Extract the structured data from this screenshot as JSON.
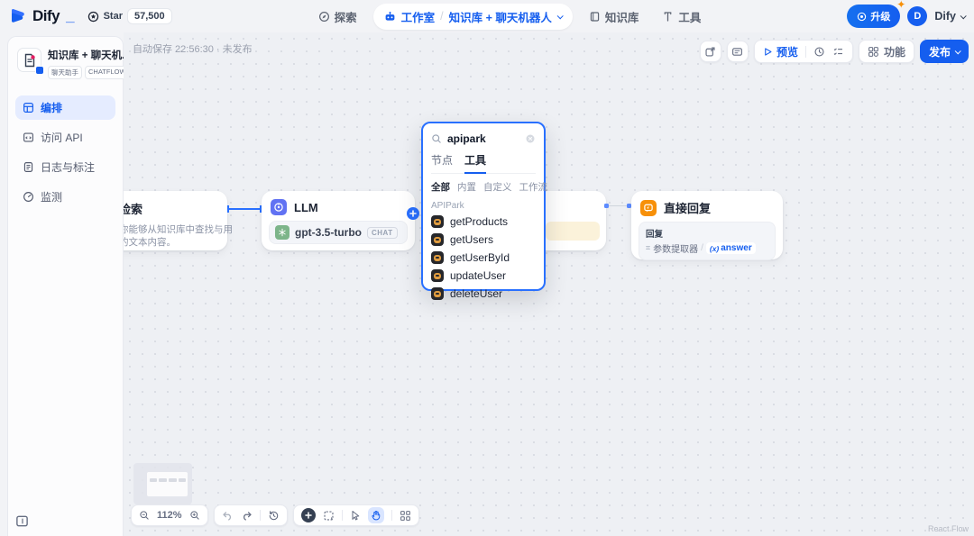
{
  "header": {
    "logo_text": "Dify",
    "logo_underscore": "_",
    "github": {
      "star_label": "Star",
      "star_count": "57,500"
    },
    "nav": {
      "explore": "探索",
      "studio": "工作室",
      "breadcrumb_separator": "/",
      "app_name": "知识库 + 聊天机器人",
      "knowledge": "知识库",
      "tools": "工具"
    },
    "upgrade_label": "升级",
    "account": {
      "avatar_initial": "D",
      "name": "Dify"
    }
  },
  "sidebar": {
    "app": {
      "title": "知识库 + 聊天机...",
      "badges": [
        "聊天助手",
        "CHATFLOW"
      ]
    },
    "items": [
      {
        "label": "编排",
        "active": true
      },
      {
        "label": "访问 API",
        "active": false
      },
      {
        "label": "日志与标注",
        "active": false
      },
      {
        "label": "监测",
        "active": false
      }
    ]
  },
  "canvas": {
    "autosave": "自动保存 22:56:30 · 未发布",
    "toolbar": {
      "preview": "预览",
      "features": "功能",
      "publish": "发布"
    },
    "zoom_level": "112%",
    "attribution": "React Flow"
  },
  "nodes": {
    "retrieval": {
      "title": "检索",
      "desc_line1": "你能够从知识库中查找与用",
      "desc_line2": "的文本内容。"
    },
    "llm": {
      "title": "LLM",
      "model": "gpt-3.5-turbo",
      "model_badge": "CHAT"
    },
    "answer": {
      "title": "直接回复",
      "section_label": "回复",
      "var_source": "参数提取器",
      "var_sep": "/",
      "var_prefix": "(x)",
      "var_name": "answer"
    }
  },
  "popup": {
    "search_value": "apipark",
    "tabs": [
      {
        "label": "节点",
        "active": false
      },
      {
        "label": "工具",
        "active": true
      }
    ],
    "filters": [
      {
        "label": "全部",
        "active": true
      },
      {
        "label": "内置",
        "active": false
      },
      {
        "label": "自定义",
        "active": false
      },
      {
        "label": "工作流",
        "active": false
      }
    ],
    "section": "APIPark",
    "items": [
      "getProducts",
      "getUsers",
      "getUserById",
      "updateUser",
      "deleteUser"
    ]
  },
  "colors": {
    "primary": "#155eef",
    "edge_blue": "#2970ff",
    "edge_gray": "#d0d5dd",
    "llm_icon": "#6172f3",
    "openai_icon": "#7db58a",
    "answer_icon": "#f79009",
    "popup_border": "#2970ff",
    "canvas_bg": "#eef0f4"
  },
  "icons": {
    "legend": "compass=explore, robot=studio, book=knowledge, wrench=tools, star=github-star, doc=app, grid=orchestrate, code-window=api-access, log=logs, gauge=monitoring, play=preview, clock=history, checklist=checklist, blocks=features, hand=hand-tool(active), pointer=pointer-tool, plus-circle=add-block"
  }
}
